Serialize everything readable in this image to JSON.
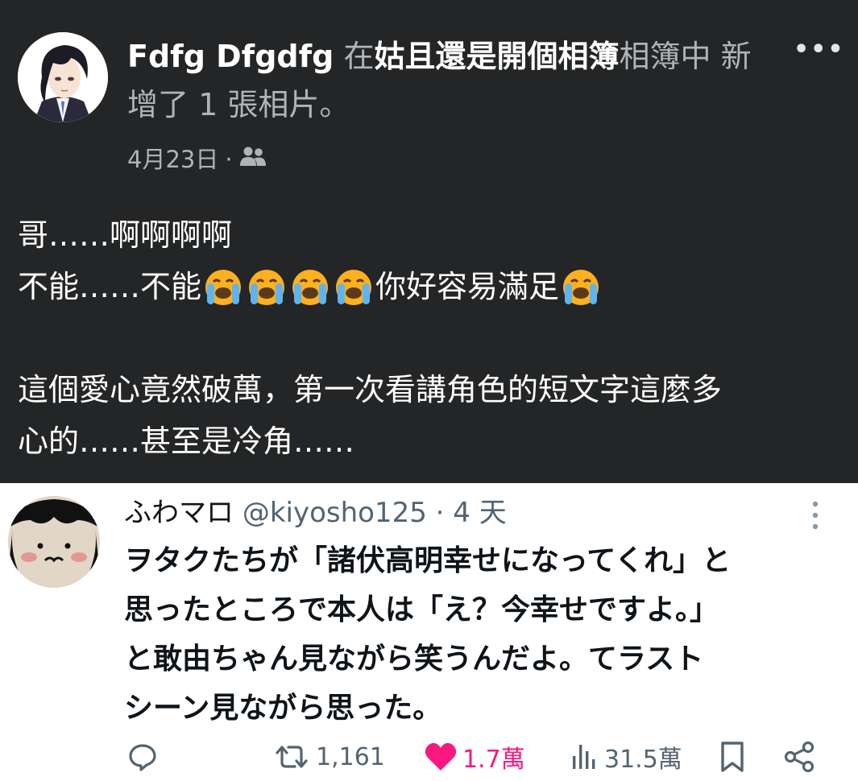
{
  "fb_post": {
    "author": "Fdfg Dfgdfg",
    "prefix": "在",
    "album_name": "姑且還是開個相簿",
    "suffix": "相簿中",
    "action": "新增了 1 張相片。",
    "date": "4月23日",
    "separator": "·",
    "audience_icon": "friends-icon",
    "more_label": "•••",
    "body": {
      "line1": "哥……啊啊啊啊",
      "line2_a": "不能……不能",
      "line2_b": "你好容易滿足",
      "line3": "這個愛心竟然破萬，第一次看講角色的短文字這麼多",
      "line4": "心的……甚至是冷角……"
    },
    "emoji": "loudly-crying-face"
  },
  "tw_post": {
    "display_name": "ふわマロ",
    "handle": "@kiyosho125",
    "dot": "·",
    "time": "4 天",
    "body": {
      "line1": "ヲタクたちが「諸伏高明幸せになってくれ」と",
      "line2": "思ったところで本人は「え？今幸せですよ。」",
      "line3": "と敢由ちゃん見ながら笑うんだよ。てラスト",
      "line4": "シーン見ながら思った。"
    },
    "actions": {
      "reply_icon": "reply-icon",
      "retweet_count": "1,161",
      "like_count": "1.7萬",
      "views_count": "31.5萬",
      "bookmark_icon": "bookmark-icon",
      "share_icon": "share-icon"
    },
    "colors": {
      "like": "#f91880",
      "muted": "#536471"
    }
  }
}
